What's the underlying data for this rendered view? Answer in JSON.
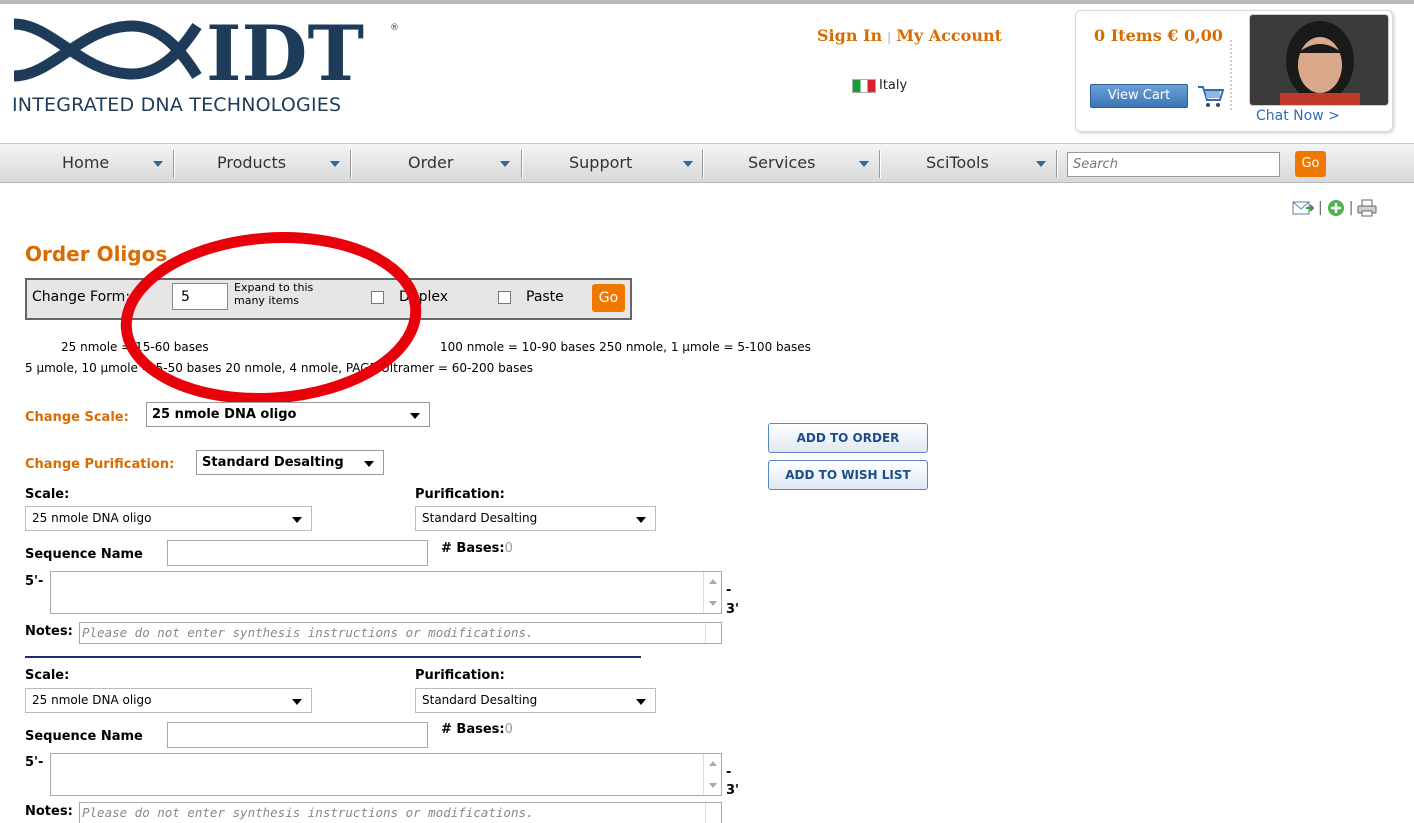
{
  "header": {
    "logo_text": "IDT",
    "logo_tagline": "INTEGRATED DNA TECHNOLOGIES",
    "sign_in": "Sign In",
    "my_account": "My Account",
    "country": "Italy",
    "cart_total": "0 Items € 0,00",
    "view_cart": "View Cart",
    "chat_now": "Chat Now >"
  },
  "nav": {
    "items": [
      {
        "label": "Home"
      },
      {
        "label": "Products"
      },
      {
        "label": "Order"
      },
      {
        "label": "Support"
      },
      {
        "label": "Services"
      },
      {
        "label": "SciTools"
      }
    ],
    "search_placeholder": "Search",
    "search_go": "Go"
  },
  "page": {
    "title": "Order Oligos",
    "change_form": {
      "label": "Change Form:",
      "count": "5",
      "expand_text": "Expand to this many items",
      "duplex": "Duplex",
      "paste": "Paste",
      "go": "Go"
    },
    "info_line1_a": "25 nmole = 15-60 bases",
    "info_line1_b": "100 nmole =  10-90 bases    250 nmole, 1 µmole = 5-100 bases",
    "info_line2": "5 µmole, 10 µmole = 5-50 bases    20 nmole, 4 nmole, PAGE Ultramer = 60-200 bases",
    "change_scale_label": "Change Scale:",
    "change_scale_value": "25 nmole DNA oligo",
    "change_purification_label": "Change Purification:",
    "change_purification_value": "Standard Desalting",
    "add_to_order": "ADD TO ORDER",
    "add_to_wish_list": "ADD TO WISH LIST"
  },
  "items": [
    {
      "scale_label": "Scale:",
      "scale_value": "25 nmole DNA oligo",
      "purification_label": "Purification:",
      "purification_value": "Standard Desalting",
      "sequence_name_label": "Sequence Name",
      "bases_label": "# Bases:",
      "bases_value": "0",
      "five_prime": "5'-",
      "three_prime_dash": "-",
      "three_prime": "3'",
      "notes_label": "Notes:",
      "notes_placeholder": "Please do not enter synthesis instructions or modifications."
    },
    {
      "scale_label": "Scale:",
      "scale_value": "25 nmole DNA oligo",
      "purification_label": "Purification:",
      "purification_value": "Standard Desalting",
      "sequence_name_label": "Sequence Name",
      "bases_label": "# Bases:",
      "bases_value": "0",
      "five_prime": "5'-",
      "three_prime_dash": "-",
      "three_prime": "3'",
      "notes_label": "Notes:",
      "notes_placeholder": "Please do not enter synthesis instructions or modifications."
    }
  ],
  "colors": {
    "brand_orange": "#d96b00",
    "button_orange": "#f07800",
    "link_blue": "#2f6db3",
    "annotation_red": "#e8000b"
  }
}
